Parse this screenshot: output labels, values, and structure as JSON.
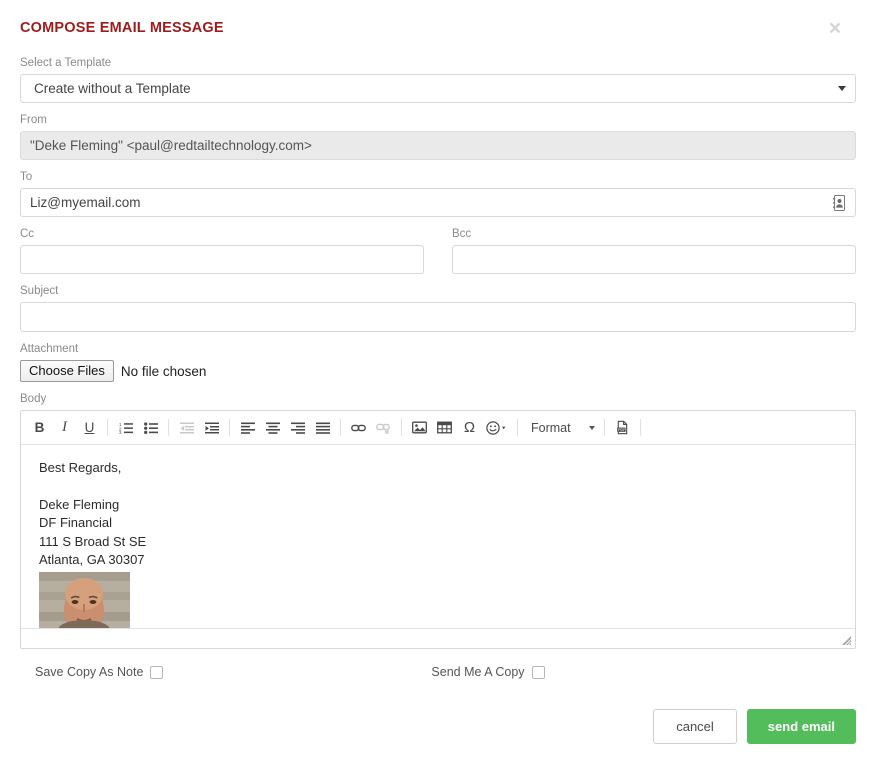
{
  "header": {
    "title": "COMPOSE EMAIL MESSAGE",
    "close_label": "×"
  },
  "form": {
    "template": {
      "label": "Select a Template",
      "selected": "Create without a Template",
      "options": [
        "Create without a Template"
      ]
    },
    "from": {
      "label": "From",
      "value": "\"Deke Fleming\" <paul@redtailtechnology.com>",
      "readonly": true
    },
    "to": {
      "label": "To",
      "value": "Liz@myemail.com",
      "placeholder": "",
      "icon": "address-book-icon"
    },
    "cc": {
      "label": "Cc",
      "value": "",
      "placeholder": ""
    },
    "bcc": {
      "label": "Bcc",
      "value": "",
      "placeholder": ""
    },
    "subject": {
      "label": "Subject",
      "value": "",
      "placeholder": ""
    },
    "attachment": {
      "label": "Attachment",
      "button_label": "Choose Files",
      "status": "No file chosen"
    },
    "body": {
      "label": "Body",
      "lines": [
        "Best Regards,",
        "",
        "Deke Fleming",
        "DF Financial",
        "111 S Broad St SE",
        "Atlanta, GA 30307"
      ],
      "signature_image_alt": "profile-photo"
    }
  },
  "toolbar": {
    "items": [
      {
        "name": "bold-icon",
        "glyph": "B",
        "style": "bold",
        "disabled": false
      },
      {
        "name": "italic-icon",
        "glyph": "I",
        "style": "italic",
        "disabled": false
      },
      {
        "name": "underline-icon",
        "glyph": "U",
        "style": "under",
        "disabled": false
      },
      {
        "name": "numbered-list-icon",
        "glyph": "",
        "style": "svg",
        "disabled": false
      },
      {
        "name": "bulleted-list-icon",
        "glyph": "",
        "style": "svg",
        "disabled": false
      },
      {
        "name": "outdent-icon",
        "glyph": "",
        "style": "svg",
        "disabled": true
      },
      {
        "name": "indent-icon",
        "glyph": "",
        "style": "svg",
        "disabled": false
      },
      {
        "name": "align-left-icon",
        "glyph": "",
        "style": "svg",
        "disabled": false
      },
      {
        "name": "align-center-icon",
        "glyph": "",
        "style": "svg",
        "disabled": false
      },
      {
        "name": "align-right-icon",
        "glyph": "",
        "style": "svg",
        "disabled": false
      },
      {
        "name": "align-justify-icon",
        "glyph": "",
        "style": "svg",
        "disabled": false
      },
      {
        "name": "link-icon",
        "glyph": "",
        "style": "svg",
        "disabled": false
      },
      {
        "name": "unlink-icon",
        "glyph": "",
        "style": "svg",
        "disabled": true
      },
      {
        "name": "image-icon",
        "glyph": "",
        "style": "svg",
        "disabled": false
      },
      {
        "name": "table-icon",
        "glyph": "",
        "style": "svg",
        "disabled": false
      },
      {
        "name": "special-character-icon",
        "glyph": "Ω",
        "style": "omega",
        "disabled": false
      },
      {
        "name": "emoji-icon",
        "glyph": "",
        "style": "svg",
        "disabled": false
      },
      {
        "name": "pdf-icon",
        "glyph": "",
        "style": "svg",
        "disabled": false
      }
    ],
    "format_label": "Format"
  },
  "options": {
    "save_copy_as_note": {
      "label": "Save Copy As Note",
      "checked": false
    },
    "send_me_a_copy": {
      "label": "Send Me A Copy",
      "checked": false
    }
  },
  "actions": {
    "cancel_label": "cancel",
    "send_label": "send email"
  },
  "colors": {
    "title": "#9e1b1b",
    "send_button": "#53bd5c",
    "border": "#d8d8d8",
    "readonly_bg": "#eaeaea"
  }
}
